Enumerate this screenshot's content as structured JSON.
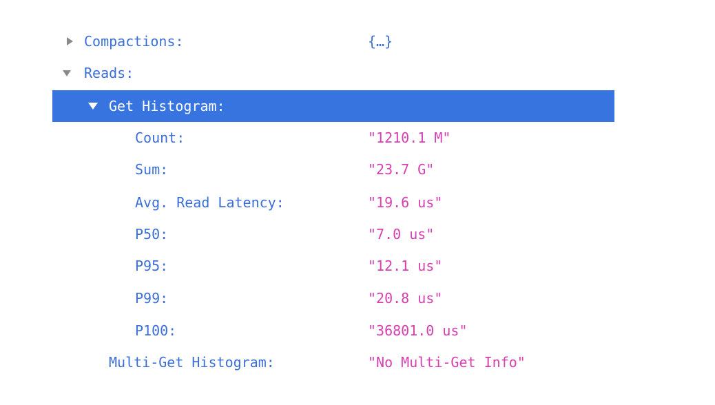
{
  "tree": {
    "compactions": {
      "key": "Compactions:",
      "value": "{…}"
    },
    "reads": {
      "key": "Reads:"
    },
    "get_histogram": {
      "key": "Get Histogram:",
      "entries": [
        {
          "key": "Count:",
          "value": "\"1210.1 M\""
        },
        {
          "key": "Sum:",
          "value": "\"23.7 G\""
        },
        {
          "key": "Avg. Read Latency:",
          "value": "\"19.6 us\""
        },
        {
          "key": "P50:",
          "value": "\"7.0 us\""
        },
        {
          "key": "P95:",
          "value": "\"12.1 us\""
        },
        {
          "key": "P99:",
          "value": "\"20.8 us\""
        },
        {
          "key": "P100:",
          "value": "\"36801.0 us\""
        }
      ]
    },
    "multi_get_histogram": {
      "key": "Multi-Get Histogram:",
      "value": "\"No Multi-Get Info\""
    }
  },
  "colors": {
    "key": "#3c6fd6",
    "string_value": "#d63fb0",
    "selection": "#3874e0",
    "triangle": "#8a8a8a"
  },
  "icons": {
    "collapsed": "triangle-right-icon",
    "expanded": "triangle-down-icon"
  }
}
